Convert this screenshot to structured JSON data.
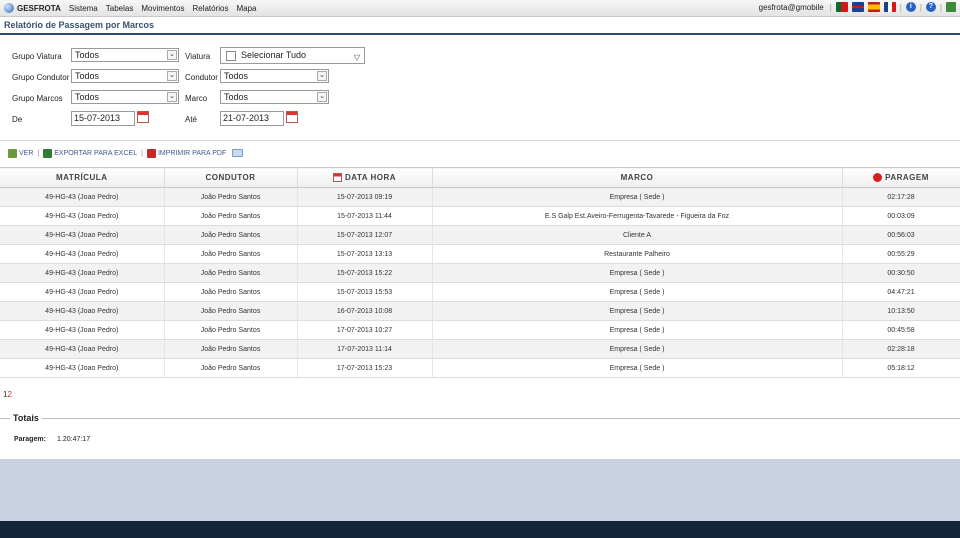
{
  "topbar": {
    "brand": "GESFROTA",
    "menu": [
      "Sistema",
      "Tabelas",
      "Movimentos",
      "Relatórios",
      "Mapa"
    ],
    "user": "gesfrota@gmobile",
    "separator": "|",
    "icons": [
      "flag-pt-icon",
      "flag-gb-icon",
      "flag-es-icon",
      "flag-fr-icon",
      "info-icon",
      "help-icon",
      "exit-icon"
    ]
  },
  "page": {
    "title": "Relatório de Passagem por Marcos"
  },
  "filters": {
    "grupo_viatura": {
      "label": "Grupo Viatura",
      "value": "Todos"
    },
    "viatura": {
      "label": "Viatura",
      "value": "Selecionar Tudo"
    },
    "grupo_condutor": {
      "label": "Grupo Condutor",
      "value": "Todos"
    },
    "condutor": {
      "label": "Condutor",
      "value": "Todos"
    },
    "grupo_marcos": {
      "label": "Grupo Marcos",
      "value": "Todos"
    },
    "marco": {
      "label": "Marco",
      "value": "Todos"
    },
    "de": {
      "label": "De",
      "value": "15-07-2013"
    },
    "ate": {
      "label": "Até",
      "value": "21-07-2013"
    }
  },
  "toolbar": {
    "ver": "VER",
    "exportar": "EXPORTAR PARA EXCEL",
    "imprimir": "IMPRIMIR PARA PDF",
    "sep": "|"
  },
  "table": {
    "headers": {
      "matricula": "MATRÍCULA",
      "condutor": "CONDUTOR",
      "data_hora": "DATA HORA",
      "marco": "MARCO",
      "paragem": "PARAGEM"
    },
    "rows": [
      {
        "matricula": "49-HG-43 (Joao Pedro)",
        "condutor": "João Pedro Santos",
        "data_hora": "15-07-2013 09:19",
        "marco": "Empresa ( Sede )",
        "paragem": "02:17:28"
      },
      {
        "matricula": "49-HG-43 (Joao Pedro)",
        "condutor": "João Pedro Santos",
        "data_hora": "15-07-2013 11:44",
        "marco": "E.S Galp Est.Aveiro-Ferrugenta-Tavarede - Figueira da Foz",
        "paragem": "00:03:09"
      },
      {
        "matricula": "49-HG-43 (Joao Pedro)",
        "condutor": "João Pedro Santos",
        "data_hora": "15-07-2013 12:07",
        "marco": "Cliente A",
        "paragem": "00:56:03"
      },
      {
        "matricula": "49-HG-43 (Joao Pedro)",
        "condutor": "João Pedro Santos",
        "data_hora": "15-07-2013 13:13",
        "marco": "Restaurante Palheiro",
        "paragem": "00:55:29"
      },
      {
        "matricula": "49-HG-43 (Joao Pedro)",
        "condutor": "João Pedro Santos",
        "data_hora": "15-07-2013 15:22",
        "marco": "Empresa ( Sede )",
        "paragem": "00:30:50"
      },
      {
        "matricula": "49-HG-43 (Joao Pedro)",
        "condutor": "João Pedro Santos",
        "data_hora": "15-07-2013 15:53",
        "marco": "Empresa ( Sede )",
        "paragem": "04:47:21"
      },
      {
        "matricula": "49-HG-43 (Joao Pedro)",
        "condutor": "João Pedro Santos",
        "data_hora": "16-07-2013 10:08",
        "marco": "Empresa ( Sede )",
        "paragem": "10:13:50"
      },
      {
        "matricula": "49-HG-43 (Joao Pedro)",
        "condutor": "João Pedro Santos",
        "data_hora": "17-07-2013 10:27",
        "marco": "Empresa ( Sede )",
        "paragem": "00:45:58"
      },
      {
        "matricula": "49-HG-43 (Joao Pedro)",
        "condutor": "João Pedro Santos",
        "data_hora": "17-07-2013 11:14",
        "marco": "Empresa ( Sede )",
        "paragem": "02:28:18"
      },
      {
        "matricula": "49-HG-43 (Joao Pedro)",
        "condutor": "João Pedro Santos",
        "data_hora": "17-07-2013 15:23",
        "marco": "Empresa ( Sede )",
        "paragem": "05:18:12"
      }
    ]
  },
  "pager": {
    "pages": [
      "1",
      "2"
    ]
  },
  "totals": {
    "legend": "Totais",
    "paragem_label": "Paragem:",
    "paragem_value": "1.20:47:17"
  },
  "colors": {
    "title": "#3a5270",
    "title_rule": "#2e4a6e",
    "link": "#3a5a88",
    "footer": "#11263b",
    "band": "#c8d2e0"
  }
}
